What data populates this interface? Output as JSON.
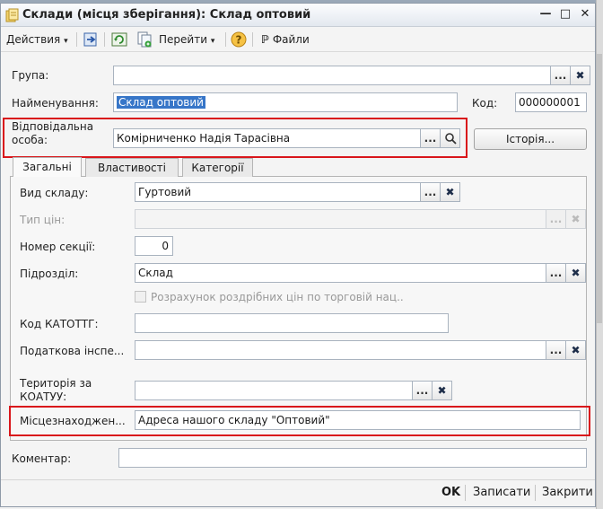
{
  "window": {
    "title": "Склади (місця зберігання): Склад оптовий"
  },
  "toolbar": {
    "actions_label": "Действия",
    "goto_label": "Перейти",
    "files_label": "Файли"
  },
  "form": {
    "group_label": "Група:",
    "group_value": "",
    "name_label": "Найменування:",
    "name_value": "Склад оптовий",
    "code_label": "Код:",
    "code_value": "000000001",
    "responsible_label_1": "Відповідальна",
    "responsible_label_2": "особа:",
    "responsible_value": "Комірниченко Надія Тарасівна",
    "history_button": "Історія..."
  },
  "tabs": [
    {
      "label": "Загальні",
      "active": true
    },
    {
      "label": "Властивості",
      "active": false
    },
    {
      "label": "Категорії",
      "active": false
    }
  ],
  "general": {
    "warehouse_type_label": "Вид складу:",
    "warehouse_type_value": "Гуртовий",
    "price_type_label": "Тип цін:",
    "price_type_value": "",
    "section_number_label": "Номер секції:",
    "section_number_value": "0",
    "division_label": "Підрозділ:",
    "division_value": "Склад",
    "retail_calc_label": "Розрахунок роздрібних цін по торговій нац..",
    "katottg_label": "Код КАТОТТГ:",
    "katottg_value": "",
    "tax_label": "Податкова інспе...",
    "tax_value": "",
    "territory_label_1": "Територія за",
    "territory_label_2": "КОАТУУ:",
    "territory_value": "",
    "location_label": "Місцезнаходжен...",
    "location_value": "Адреса нашого складу \"Оптовий\""
  },
  "comment": {
    "label": "Коментар:",
    "value": ""
  },
  "footer": {
    "ok": "OK",
    "save": "Записати",
    "close": "Закрити"
  }
}
